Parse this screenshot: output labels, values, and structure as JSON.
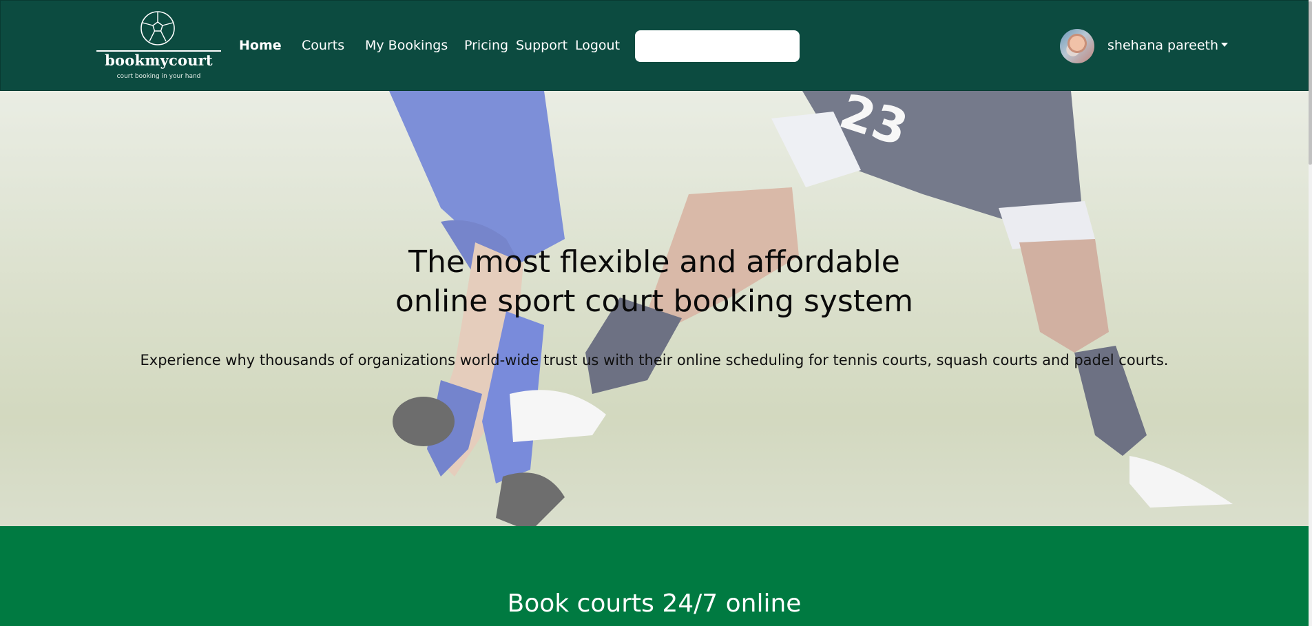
{
  "brand": {
    "name": "bookmycourt",
    "tagline": "court booking in your hand",
    "logo_icon": "soccer-ball-icon"
  },
  "nav": {
    "items": [
      {
        "label": "Home",
        "active": true
      },
      {
        "label": "Courts",
        "active": false
      },
      {
        "label": "My Bookings",
        "active": false
      },
      {
        "label": "Pricing",
        "active": false
      },
      {
        "label": "Support",
        "active": false
      },
      {
        "label": "Logout",
        "active": false
      }
    ],
    "search": {
      "value": "",
      "placeholder": ""
    }
  },
  "user": {
    "name": "shehana pareeth",
    "menu_icon": "caret-down-icon"
  },
  "hero": {
    "title_line1": "The most flexible and affordable",
    "title_line2": "online sport court booking system",
    "subtitle": "Experience why thousands of organizations world-wide trust us with their online scheduling for tennis courts, squash courts and padel courts."
  },
  "section": {
    "title": "Book courts 24/7 online"
  },
  "colors": {
    "navbar": "#0c4b40",
    "band": "#007a41",
    "text_on_dark": "#ffffff"
  }
}
